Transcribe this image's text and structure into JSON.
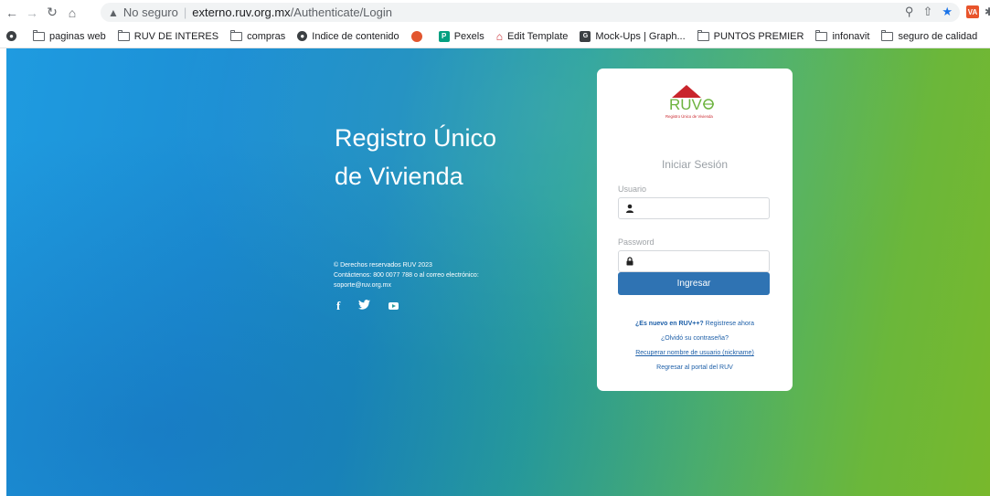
{
  "browser": {
    "security_label": "No seguro",
    "url_domain": "externo.ruv.org.mx",
    "url_path": "/Authenticate/Login",
    "extension_badge": "VA"
  },
  "bookmarks": [
    {
      "icon": "globe-icon",
      "label": ""
    },
    {
      "icon": "folder-icon",
      "label": "paginas web"
    },
    {
      "icon": "folder-icon",
      "label": "RUV DE INTERES"
    },
    {
      "icon": "folder-icon",
      "label": "compras"
    },
    {
      "icon": "globe-icon",
      "label": "Indice de contenido"
    },
    {
      "icon": "shield-icon",
      "label": ""
    },
    {
      "icon": "pexels-icon",
      "label": "Pexels"
    },
    {
      "icon": "house-icon",
      "label": "Edit Template"
    },
    {
      "icon": "mockup-icon",
      "label": "Mock-Ups | Graph..."
    },
    {
      "icon": "folder-icon",
      "label": "PUNTOS PREMIER"
    },
    {
      "icon": "folder-icon",
      "label": "infonavit"
    },
    {
      "icon": "folder-icon",
      "label": "seguro de calidad"
    }
  ],
  "hero": {
    "line1": "Registro Único",
    "line2": "de Vivienda"
  },
  "footer": {
    "copyright": "© Derechos reservados RUV 2023",
    "contact": "Contáctenos: 800 0077 788 o al correo electrónico:",
    "email": "soporte@ruv.org.mx"
  },
  "logo": {
    "text": "RUV",
    "tagline": "Registro Único de Vivienda"
  },
  "login": {
    "title": "Iniciar Sesión",
    "user_label": "Usuario",
    "user_value": "",
    "password_label": "Password",
    "password_value": "",
    "submit_label": "Ingresar",
    "new_prefix": "¿Es nuevo en RUV++?",
    "new_link": "Registrese ahora",
    "forgot_password": "¿Olvidó su contraseña?",
    "recover_username": "Recuperar nombre de usuario (nickname)",
    "back_portal": "Regresar al portal del RUV"
  },
  "colors": {
    "primary_button": "#2f73b3",
    "link": "#1d5fa8",
    "logo_green": "#6db33f",
    "logo_red": "#c9252c"
  }
}
